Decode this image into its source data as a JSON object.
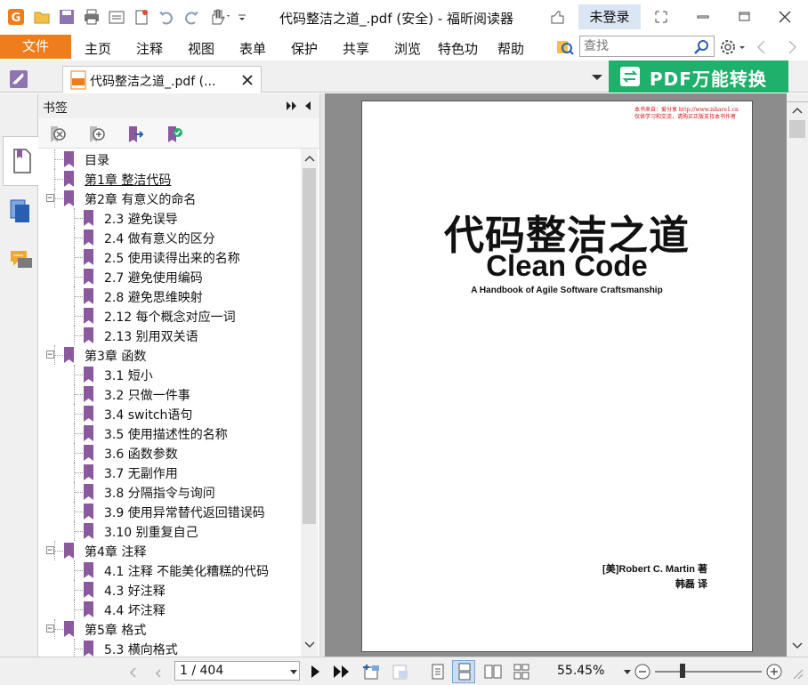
{
  "window": {
    "title": "代码整洁之道_.pdf (安全) - 福昕阅读器",
    "login_label": "未登录"
  },
  "menu": {
    "file_label": "文件",
    "items": [
      "主页",
      "注释",
      "视图",
      "表单",
      "保护",
      "共享",
      "浏览",
      "特色功",
      "帮助"
    ],
    "search_placeholder": "查找"
  },
  "tab": {
    "label": "代码整洁之道_.pdf (...",
    "promo_label": "PDF万能转换"
  },
  "bookmarks": {
    "header": "书签",
    "items": [
      {
        "label": "目录",
        "level": 0,
        "toggle": ""
      },
      {
        "label": "第1章 整洁代码",
        "level": 0,
        "toggle": ""
      },
      {
        "label": "第2章 有意义的命名",
        "level": 0,
        "toggle": "−"
      },
      {
        "label": "2.3 避免误导",
        "level": 1,
        "toggle": ""
      },
      {
        "label": "2.4 做有意义的区分",
        "level": 1,
        "toggle": ""
      },
      {
        "label": "2.5 使用读得出来的名称",
        "level": 1,
        "toggle": ""
      },
      {
        "label": "2.7 避免使用编码",
        "level": 1,
        "toggle": ""
      },
      {
        "label": "2.8 避免思维映射",
        "level": 1,
        "toggle": ""
      },
      {
        "label": "2.12 每个概念对应一词",
        "level": 1,
        "toggle": ""
      },
      {
        "label": "2.13 别用双关语",
        "level": 1,
        "toggle": ""
      },
      {
        "label": "第3章 函数",
        "level": 0,
        "toggle": "−"
      },
      {
        "label": "3.1 短小",
        "level": 1,
        "toggle": ""
      },
      {
        "label": "3.2 只做一件事",
        "level": 1,
        "toggle": ""
      },
      {
        "label": "3.4 switch语句",
        "level": 1,
        "toggle": ""
      },
      {
        "label": "3.5 使用描述性的名称",
        "level": 1,
        "toggle": ""
      },
      {
        "label": "3.6 函数参数",
        "level": 1,
        "toggle": ""
      },
      {
        "label": "3.7 无副作用",
        "level": 1,
        "toggle": ""
      },
      {
        "label": "3.8 分隔指令与询问",
        "level": 1,
        "toggle": ""
      },
      {
        "label": "3.9 使用异常替代返回错误码",
        "level": 1,
        "toggle": ""
      },
      {
        "label": "3.10 别重复自己",
        "level": 1,
        "toggle": ""
      },
      {
        "label": "第4章 注释",
        "level": 0,
        "toggle": "−"
      },
      {
        "label": "4.1 注释 不能美化糟糕的代码",
        "level": 1,
        "toggle": ""
      },
      {
        "label": "4.3 好注释",
        "level": 1,
        "toggle": ""
      },
      {
        "label": "4.4 坏注释",
        "level": 1,
        "toggle": ""
      },
      {
        "label": "第5章 格式",
        "level": 0,
        "toggle": "−"
      },
      {
        "label": "5.3 横向格式",
        "level": 1,
        "toggle": ""
      }
    ]
  },
  "document": {
    "watermark_line1": "本书来自：爱分享 http://www.ishare1.cn",
    "watermark_line2": "仅供学习和交流，请购买正版支持本书作者",
    "title_cn": "代码整洁之道",
    "title_en": "Clean Code",
    "subtitle": "A Handbook of Agile Software Craftsmanship",
    "author": "[美]Robert C. Martin  著",
    "translator": "韩磊  译"
  },
  "status": {
    "page": "1 / 404",
    "zoom": "55.45%"
  },
  "colors": {
    "accent_orange": "#ef7d1b",
    "promo_green": "#1fb16b",
    "bookmark_purple": "#8b5a9e"
  }
}
